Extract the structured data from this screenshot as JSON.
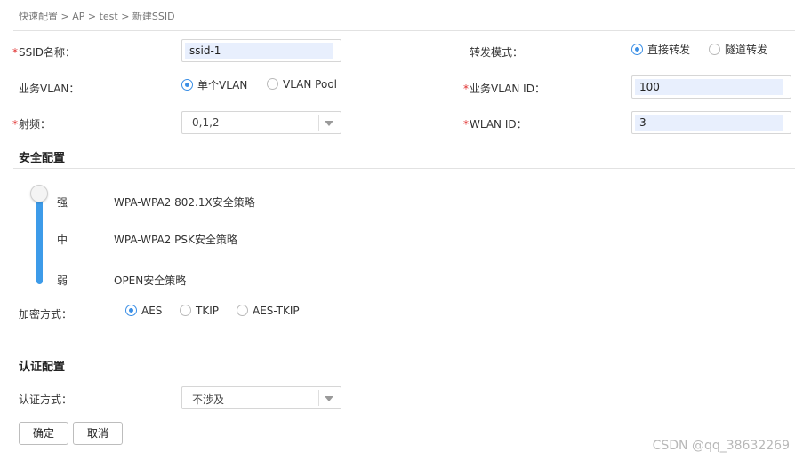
{
  "breadcrumb": "快速配置 > AP > test > 新建SSID",
  "form": {
    "ssid_name_label": "SSID名称：",
    "ssid_name_value": "ssid-1",
    "forward_mode_label": "转发模式：",
    "forward_mode_options": [
      "直接转发",
      "隧道转发"
    ],
    "service_vlan_label": "业务VLAN：",
    "service_vlan_options": [
      "单个VLAN",
      "VLAN Pool"
    ],
    "service_vlan_id_label": "业务VLAN ID：",
    "service_vlan_id_value": "100",
    "radio_label": "射频：",
    "radio_value": "0,1,2",
    "wlan_id_label": "WLAN ID：",
    "wlan_id_value": "3"
  },
  "security": {
    "title": "安全配置",
    "levels": [
      {
        "level": "强",
        "policy": "WPA-WPA2 802.1X安全策略"
      },
      {
        "level": "中",
        "policy": "WPA-WPA2 PSK安全策略"
      },
      {
        "level": "弱",
        "policy": "OPEN安全策略"
      }
    ],
    "slider_level": "强",
    "encryption_label": "加密方式：",
    "encryption_options": [
      "AES",
      "TKIP",
      "AES-TKIP"
    ]
  },
  "auth": {
    "title": "认证配置",
    "method_label": "认证方式：",
    "method_value": "不涉及"
  },
  "buttons": {
    "ok": "确定",
    "cancel": "取消"
  },
  "watermark": "CSDN @qq_38632269",
  "colors": {
    "accent": "#3b8fe6",
    "required": "#e0302f",
    "input_fill": "#e8effd"
  }
}
